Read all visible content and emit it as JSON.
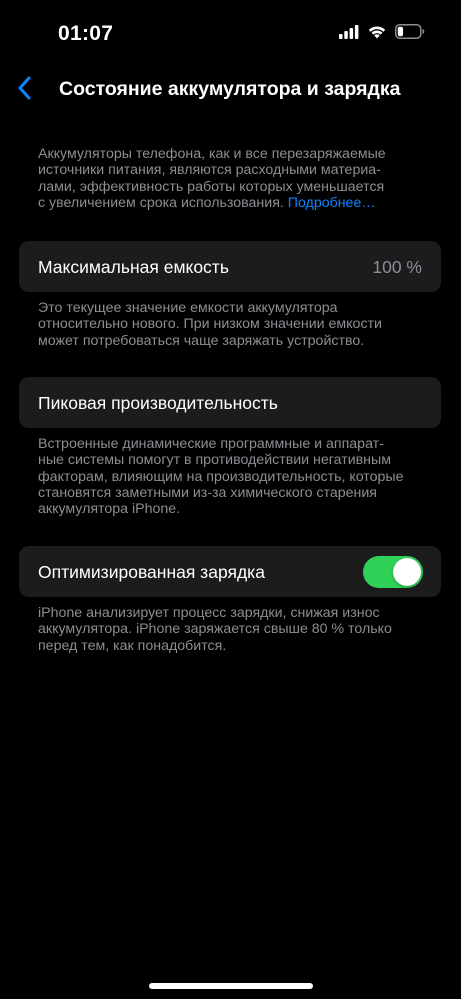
{
  "status_bar": {
    "time": "01:07",
    "signal_icon": "signal-icon",
    "wifi_icon": "wifi-icon",
    "battery_icon": "battery-icon",
    "battery_level": 0.25
  },
  "nav": {
    "back_icon": "chevron-left-icon",
    "title": "Состояние аккумулятора и зарядка"
  },
  "intro": {
    "text": "Аккумуляторы телефона, как и все перезаряжаемые\nисточники питания, являются расходными материа-\nлами, эффективность работы которых уменьшается\nс увеличением срока использования. ",
    "link": "Подробнее…"
  },
  "max_capacity": {
    "label": "Максимальная емкость",
    "value": "100 %",
    "note": "Это текущее значение емкости аккумулятора\nотносительно нового. При низком значении емкости\nможет потребоваться чаще заряжать устройство."
  },
  "peak_performance": {
    "label": "Пиковая производительность",
    "note": "Встроенные динамические программные и аппарат-\nные системы помогут в противодействии негативным\nфакторам, влияющим на производительность, которые\nстановятся заметными из-за химического старения\nаккумулятора iPhone."
  },
  "optimized_charging": {
    "label": "Оптимизированная зарядка",
    "enabled": true,
    "note": "iPhone анализирует процесс зарядки, снижая износ\nаккумулятора. iPhone заряжается свыше 80 % только\nперед тем, как понадобится."
  },
  "colors": {
    "accent": "#0a84ff",
    "toggle_on": "#30d158",
    "cell_background": "#1c1c1e",
    "secondary_text": "#8d8d93",
    "background": "#000000"
  }
}
